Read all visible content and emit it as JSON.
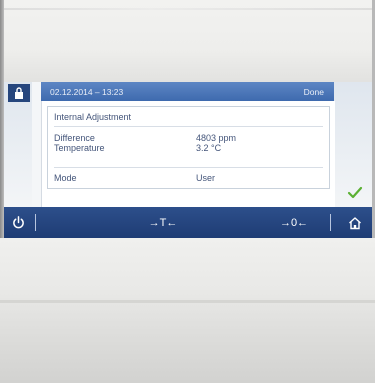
{
  "dialog": {
    "datetime": "02.12.2014 – 13:23",
    "done_label": "Done",
    "title": "Internal Adjustment",
    "rows": [
      {
        "label": "Difference",
        "value": "4803 ppm"
      },
      {
        "label": "Temperature",
        "value": "3.2 °C"
      },
      {
        "label": "Mode",
        "value": "User"
      }
    ]
  },
  "navbar": {
    "tare_label": "→T←",
    "zero_label": "→0←"
  },
  "icons": {
    "lock": "lock-icon",
    "power": "power-icon",
    "home": "home-icon",
    "check": "checkmark-icon"
  },
  "colors": {
    "header_blue": "#4a76b8",
    "navbar_blue": "#25457f",
    "check_green": "#5bb033",
    "text": "#44557a"
  }
}
